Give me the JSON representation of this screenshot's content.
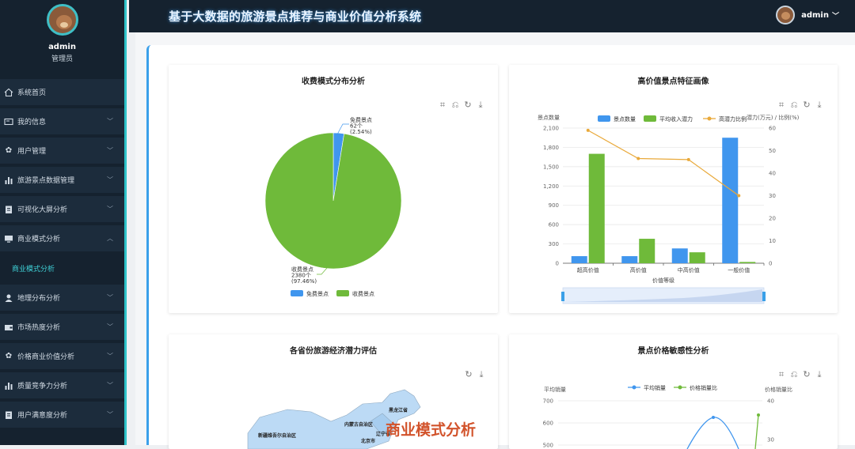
{
  "header": {
    "title": "基于大数据的旅游景点推荐与商业价值分析系统",
    "user": "admin",
    "chevron": "chevron-down-icon"
  },
  "profile": {
    "name": "admin",
    "role": "管理员"
  },
  "menu": {
    "items": [
      {
        "label": "系统首页",
        "icon": "home-icon"
      },
      {
        "label": "我的信息",
        "icon": "id-card-icon"
      },
      {
        "label": "用户管理",
        "icon": "gear-icon"
      },
      {
        "label": "旅游景点数据管理",
        "icon": "bar-chart-icon"
      },
      {
        "label": "可视化大屏分析",
        "icon": "clipboard-icon"
      },
      {
        "label": "商业模式分析",
        "icon": "monitor-icon"
      },
      {
        "label": "地理分布分析",
        "icon": "user-icon"
      },
      {
        "label": "市场热度分析",
        "icon": "wallet-icon"
      },
      {
        "label": "价格商业价值分析",
        "icon": "gear-icon"
      },
      {
        "label": "质量竞争力分析",
        "icon": "bar-chart-icon"
      },
      {
        "label": "用户满意度分析",
        "icon": "clipboard-icon"
      }
    ],
    "sub_item": "商业模式分析"
  },
  "cards": {
    "pie": {
      "title": "收费模式分布分析",
      "chart_data": {
        "type": "pie",
        "title": "收费模式分布分析",
        "slices": [
          {
            "name": "免费景点",
            "value": 62,
            "percent": "2.54%",
            "color": "#4096ee"
          },
          {
            "name": "收费景点",
            "value": 2380,
            "percent": "97.46%",
            "color": "#6fba3a"
          }
        ],
        "label_free": [
          "免费景点",
          "62个",
          "(2.54%)"
        ],
        "label_paid": [
          "收费景点",
          "2380个",
          "(97.46%)"
        ],
        "legend": [
          "免费景点",
          "收费景点"
        ]
      }
    },
    "bar": {
      "title": "高价值景点特征画像",
      "chart_data": {
        "type": "bar",
        "title": "高价值景点特征画像",
        "xlabel": "价值等级",
        "ylabel_left": "景点数量",
        "ylabel_right": "潜力(万元) / 比例(%)",
        "categories": [
          "超高价值",
          "高价值",
          "中高价值",
          "一般价值"
        ],
        "ylim_left": [
          0,
          2100
        ],
        "yticks_left": [
          "0",
          "300",
          "600",
          "900",
          "1,200",
          "1,500",
          "1,800",
          "2,100"
        ],
        "ylim_right": [
          0,
          60
        ],
        "yticks_right": [
          "0",
          "10",
          "20",
          "30",
          "40",
          "50",
          "60"
        ],
        "series": [
          {
            "name": "景点数量",
            "type": "bar",
            "axis": "left",
            "values": [
              110,
              110,
              230,
              1950
            ],
            "color": "#4096ee"
          },
          {
            "name": "平均收入潜力",
            "type": "bar",
            "axis": "left",
            "values": [
              1700,
              380,
              170,
              20
            ],
            "color": "#6fba3a"
          },
          {
            "name": "高潜力比例",
            "type": "line",
            "axis": "right",
            "values": [
              59,
              46.5,
              46,
              30
            ],
            "color": "#e9a93a"
          }
        ],
        "legend": [
          "景点数量",
          "平均收入潜力",
          "高潜力比例"
        ]
      }
    },
    "map": {
      "title": "各省份旅游经济潜力评估",
      "labels": [
        "黑龙江省",
        "内蒙古自治区",
        "新疆维吾尔自治区",
        "辽宁省",
        "北京市"
      ],
      "watermark": "商业模式分析"
    },
    "line": {
      "title": "景点价格敏感性分析",
      "chart_data": {
        "type": "line",
        "title": "景点价格敏感性分析",
        "ylabel_left": "平均销量",
        "ylabel_right": "价格销量比",
        "yticks_left": [
          "700",
          "600",
          "500"
        ],
        "yticks_right": [
          "40",
          "30"
        ],
        "series": [
          {
            "name": "平均销量",
            "color": "#4096ee"
          },
          {
            "name": "价格销量比",
            "color": "#6fba3a"
          }
        ],
        "legend": [
          "平均销量",
          "价格销量比"
        ]
      }
    }
  }
}
